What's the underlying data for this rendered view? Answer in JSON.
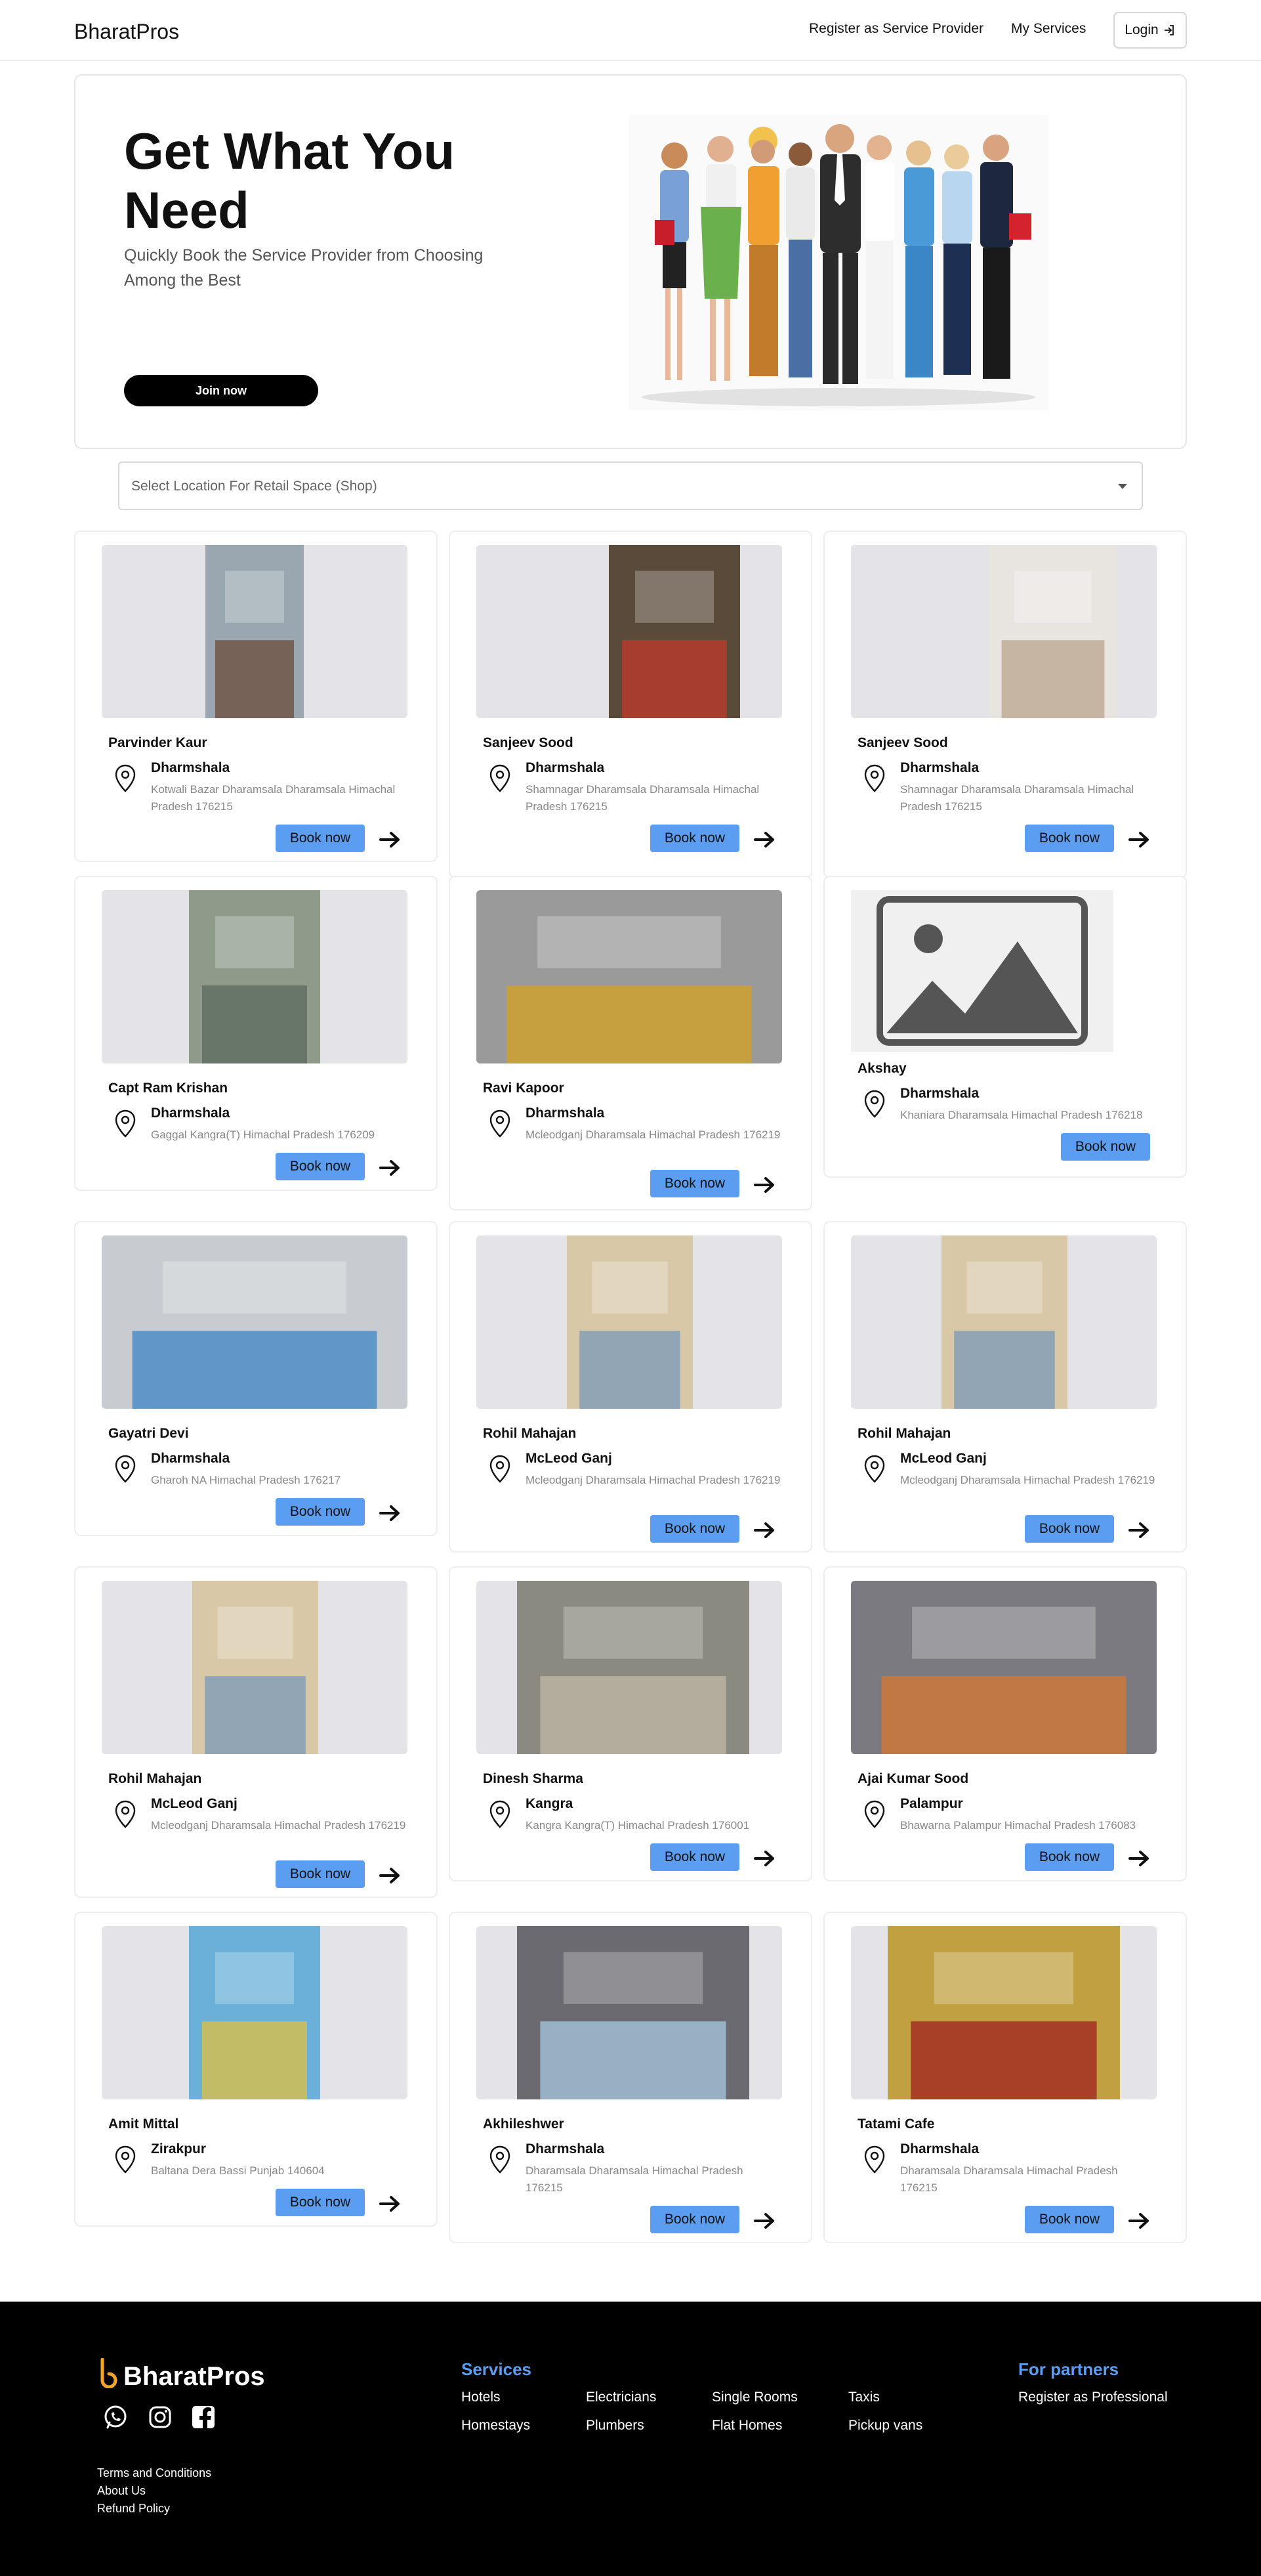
{
  "header": {
    "brand": "BharatPros",
    "nav": {
      "register": "Register as Service Provider",
      "services": "My Services",
      "login": "Login"
    }
  },
  "hero": {
    "title": "Get What You Need",
    "subtitle": "Quickly Book the Service Provider from Choosing Among the Best",
    "cta": "Join now"
  },
  "location": {
    "placeholder": "Select Location For Retail Space (Shop)"
  },
  "book_label": "Book now",
  "listings": [
    {
      "owner": "Parvinder Kaur",
      "city": "Dharmshala",
      "address": "Kotwali Bazar Dharamsala  Dharamsala  Himachal Pradesh  176215"
    },
    {
      "owner": "Sanjeev Sood",
      "city": "Dharmshala",
      "address": "Shamnagar Dharamsala  Dharamsala  Himachal Pradesh  176215"
    },
    {
      "owner": "Sanjeev Sood",
      "city": "Dharmshala",
      "address": "Shamnagar Dharamsala  Dharamsala  Himachal Pradesh  176215"
    },
    {
      "owner": "Capt Ram Krishan",
      "city": "Dharmshala",
      "address": "Gaggal  Kangra(T)  Himachal Pradesh   176209"
    },
    {
      "owner": "Ravi Kapoor",
      "city": "Dharmshala",
      "address": "Mcleodganj  Dharamsala  Himachal Pradesh  176219"
    },
    {
      "owner": "Akshay",
      "city": "Dharmshala",
      "address": "Khaniara  Dharamsala  Himachal Pradesh  176218"
    },
    {
      "owner": "Gayatri Devi",
      "city": "Dharmshala",
      "address": "Gharoh  NA  Himachal Pradesh  176217"
    },
    {
      "owner": "Rohil Mahajan",
      "city": "McLeod Ganj",
      "address": "Mcleodganj  Dharamsala  Himachal Pradesh  176219"
    },
    {
      "owner": "Rohil Mahajan",
      "city": "McLeod Ganj",
      "address": "Mcleodganj  Dharamsala  Himachal Pradesh  176219"
    },
    {
      "owner": "Rohil Mahajan",
      "city": "McLeod Ganj",
      "address": "Mcleodganj  Dharamsala  Himachal Pradesh  176219"
    },
    {
      "owner": "Dinesh Sharma",
      "city": "Kangra",
      "address": "Kangra  Kangra(T)  Himachal Pradesh  176001"
    },
    {
      "owner": "Ajai Kumar Sood",
      "city": "Palampur",
      "address": "Bhawarna  Palampur  Himachal Pradesh   176083"
    },
    {
      "owner": "Amit Mittal",
      "city": "Zirakpur",
      "address": "Baltana  Dera Bassi  Punjab   140604"
    },
    {
      "owner": "Akhileshwer",
      "city": "Dharmshala",
      "address": "Dharamsala  Dharamsala  Himachal Pradesh  176215"
    },
    {
      "owner": "Tatami Cafe",
      "city": "Dharmshala",
      "address": "Dharamsala  Dharamsala  Himachal Pradesh  176215"
    }
  ],
  "footer": {
    "brand": "BharatPros",
    "services_heading": "Services",
    "services": [
      "Hotels",
      "Electricians",
      "Single Rooms",
      "Taxis",
      "Homestays",
      "Plumbers",
      "Flat Homes",
      "Pickup vans"
    ],
    "partners_heading": "For partners",
    "partners_link": "Register as Professional",
    "links": [
      "Terms and Conditions",
      "About Us",
      "Refund Policy"
    ]
  },
  "colors": {
    "accent": "#5b9df0",
    "logo_orange": "#f5a524",
    "footer_bg": "#000000"
  }
}
